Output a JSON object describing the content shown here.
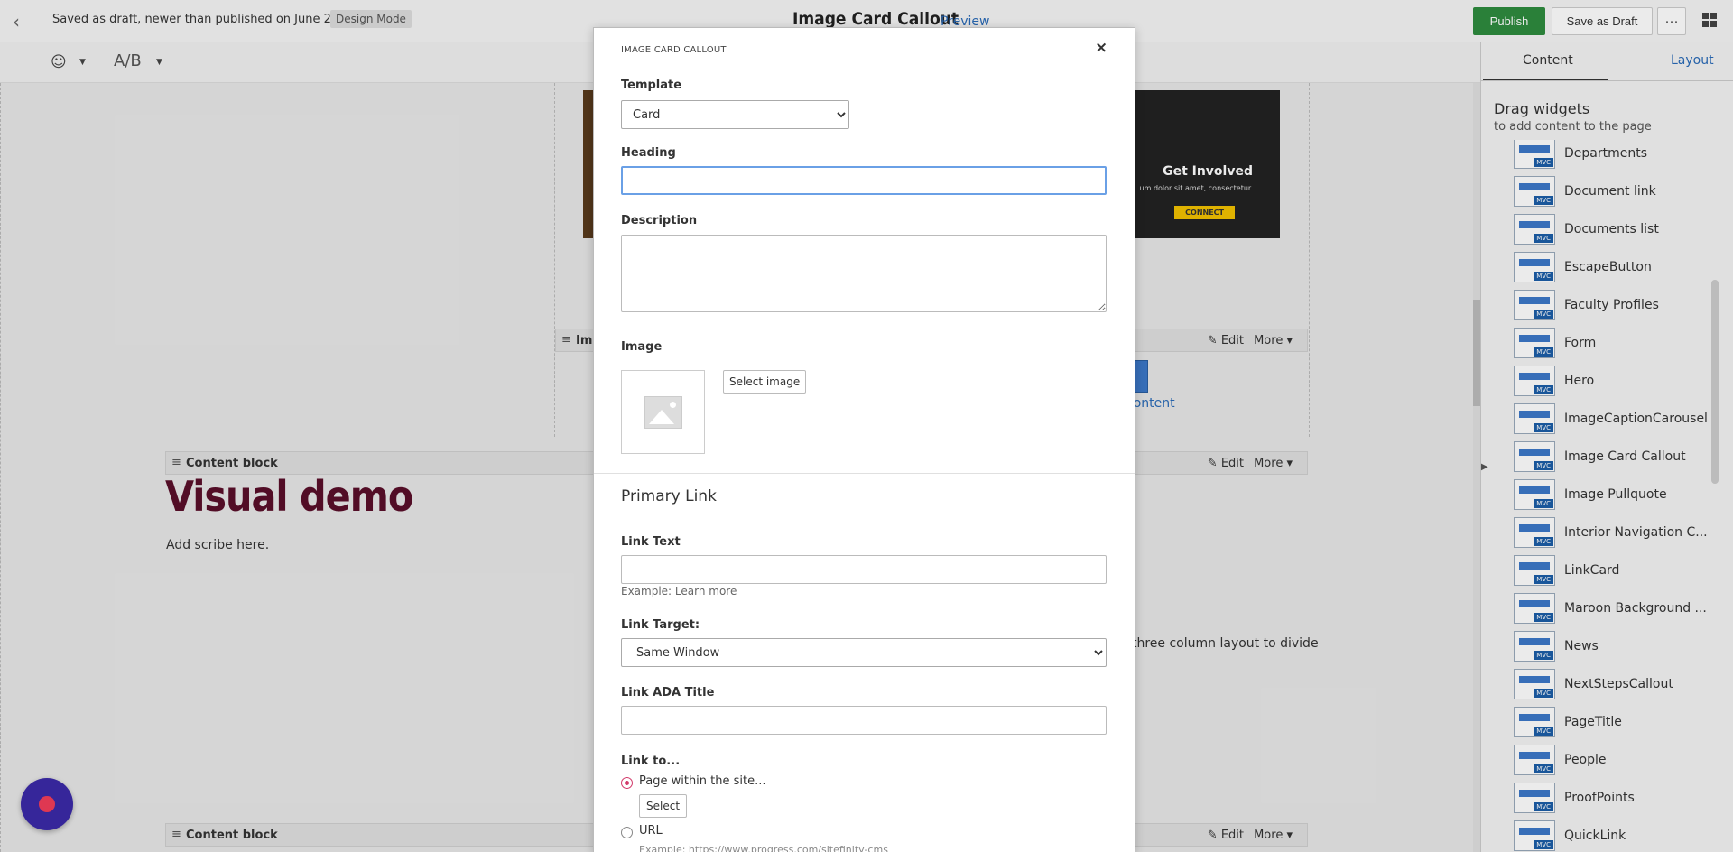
{
  "topbar": {
    "status": "Saved as draft, newer than published on June 22",
    "mode": "Design Mode",
    "title": "Image Card Callout",
    "preview": "Preview",
    "publish": "Publish",
    "save_draft": "Save as Draft",
    "more": "···"
  },
  "toolbar": {
    "ab": "A/B"
  },
  "canvas": {
    "widget_bar_1": "Im",
    "widget_bar_content": "Content block",
    "edit": "Edit",
    "more": "More",
    "visual_demo": "Visual demo",
    "scribe": "Add scribe here.",
    "three_column": "three column layout to divide",
    "dz_content": "content",
    "banner_heading": "Get Involved",
    "banner_lorem": "um dolor sit amet, consectetur.",
    "banner_cta": "CONNECT"
  },
  "panel": {
    "tab_content": "Content",
    "tab_layout": "Layout",
    "drag_title": "Drag widgets",
    "drag_sub": "to add content to the page",
    "badge": "MVC",
    "widgets": [
      "Departments",
      "Document link",
      "Documents list",
      "EscapeButton",
      "Faculty Profiles",
      "Form",
      "Hero",
      "ImageCaptionCarousel",
      "Image Card Callout",
      "Image Pullquote",
      "Interior Navigation C...",
      "LinkCard",
      "Maroon Background ...",
      "News",
      "NextStepsCallout",
      "PageTitle",
      "People",
      "ProofPoints",
      "QuickLink"
    ]
  },
  "modal": {
    "title": "IMAGE CARD CALLOUT",
    "close": "×",
    "template_label": "Template",
    "template_value": "Card",
    "heading_label": "Heading",
    "heading_value": "",
    "description_label": "Description",
    "image_label": "Image",
    "select_image": "Select image",
    "primary_link": "Primary Link",
    "link_text_label": "Link Text",
    "link_text_help": "Example: Learn more",
    "link_target_label": "Link Target:",
    "link_target_value": "Same Window",
    "ada_label": "Link ADA Title",
    "link_to_label": "Link to...",
    "radio_page": "Page within the site...",
    "select_btn": "Select",
    "radio_url": "URL",
    "url_help": "Example: https://www.progress.com/sitefinity-cms"
  }
}
